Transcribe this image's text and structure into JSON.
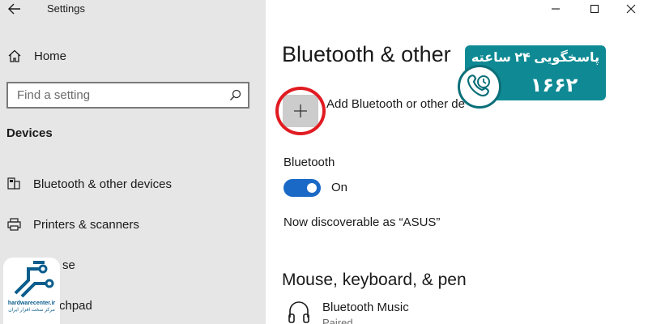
{
  "window": {
    "title": "Settings",
    "controls": {
      "back": "back-arrow-icon",
      "minimize": "minimize-icon",
      "maximize": "maximize-icon",
      "close": "close-icon"
    }
  },
  "sidebar": {
    "home_label": "Home",
    "search_placeholder": "Find a setting",
    "section_title": "Devices",
    "items": [
      {
        "label": "Bluetooth & other devices",
        "icon": "bluetooth-devices-icon"
      },
      {
        "label": "Printers & scanners",
        "icon": "printer-icon"
      },
      {
        "label": "se",
        "icon": "mouse-icon"
      },
      {
        "label": "chpad",
        "icon": "touchpad-icon"
      }
    ]
  },
  "main": {
    "title": "Bluetooth & other",
    "add_device_label": "Add Bluetooth or other de",
    "bluetooth_label": "Bluetooth",
    "bluetooth_state": "On",
    "bluetooth_on": true,
    "discoverable_text": "Now discoverable as “ASUS”",
    "section_mouse": "Mouse, keyboard, & pen",
    "devices": [
      {
        "name": "Bluetooth Music",
        "status": "Paired",
        "icon": "headphones-icon"
      }
    ]
  },
  "overlay": {
    "badge_text": "پاسخگویی ۲۴ ساعته",
    "badge_number": "۱۶۶۲",
    "badge_color": "#0f8a94",
    "logo_text": "hardwarecenter.ir",
    "logo_subtext": "مرکز سخت افزار ایران"
  },
  "colors": {
    "sidebar_bg": "#e6e6e6",
    "accent": "#1a69c6",
    "highlight_ring": "#e11b22"
  }
}
